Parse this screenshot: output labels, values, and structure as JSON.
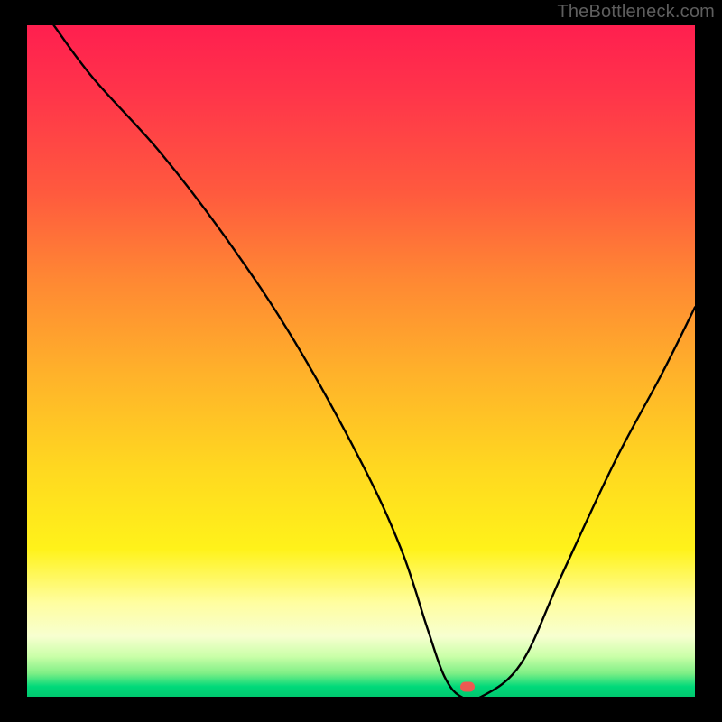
{
  "watermark": "TheBottleneck.com",
  "chart_data": {
    "type": "line",
    "title": "",
    "xlabel": "",
    "ylabel": "",
    "xlim": [
      0,
      100
    ],
    "ylim": [
      0,
      100
    ],
    "grid": false,
    "legend": false,
    "series": [
      {
        "name": "bottleneck-curve",
        "x": [
          4,
          10,
          20,
          30,
          40,
          50,
          56,
          60,
          62.5,
          65,
          68,
          74,
          80,
          88,
          95,
          100
        ],
        "y": [
          100,
          92,
          81,
          68,
          53,
          35,
          22,
          10,
          3,
          0,
          0,
          5,
          18,
          35,
          48,
          58
        ]
      }
    ],
    "annotations": [
      {
        "name": "optimum-marker",
        "x": 66,
        "y": 1.5,
        "color": "#ff4e4e"
      }
    ],
    "background_gradient": {
      "orientation": "vertical",
      "stops": [
        {
          "pos": 0.0,
          "color": "#ff1f4f"
        },
        {
          "pos": 0.5,
          "color": "#ffb22a"
        },
        {
          "pos": 0.8,
          "color": "#fff21a"
        },
        {
          "pos": 1.0,
          "color": "#00c86f"
        }
      ]
    }
  }
}
